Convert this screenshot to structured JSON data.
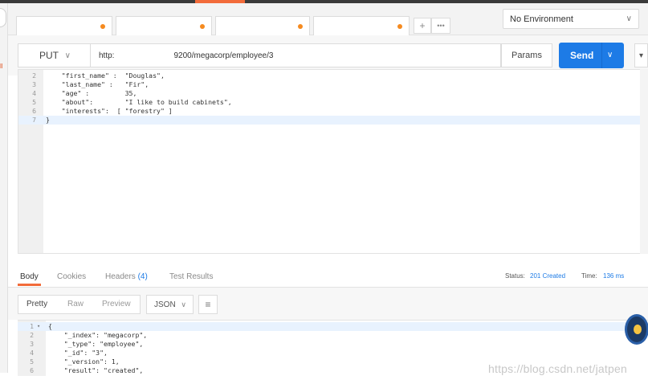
{
  "environment": {
    "selected": "No Environment"
  },
  "tabs": [
    {
      "label": "",
      "unsaved": true
    },
    {
      "label": "",
      "unsaved": true
    },
    {
      "label": "",
      "unsaved": true
    },
    {
      "label": "",
      "unsaved": true
    }
  ],
  "tab_actions": {
    "add": "+",
    "more": "•••"
  },
  "request": {
    "method": "PUT",
    "url_prefix": "http:",
    "url_suffix": "9200/megacorp/employee/3",
    "params_label": "Params",
    "send_label": "Send"
  },
  "left_edge": {
    "label": "ll"
  },
  "body_editor": {
    "lines": [
      {
        "num": "2",
        "text": "    \"first_name\" :  \"Douglas\","
      },
      {
        "num": "3",
        "text": "    \"last_name\" :   \"Fir\","
      },
      {
        "num": "4",
        "text": "    \"age\" :         35,"
      },
      {
        "num": "5",
        "text": "    \"about\":        \"I like to build cabinets\","
      },
      {
        "num": "6",
        "text": "    \"interests\":  [ \"forestry\" ]"
      },
      {
        "num": "7",
        "text": "}"
      }
    ]
  },
  "response": {
    "tabs": [
      {
        "label": "Body"
      },
      {
        "label": "Cookies"
      },
      {
        "label": "Headers",
        "count": "(4)"
      },
      {
        "label": "Test Results"
      }
    ],
    "status_label": "Status:",
    "status_value": "201 Created",
    "time_label": "Time:",
    "time_value": "136 ms",
    "formats": [
      "Pretty",
      "Raw",
      "Preview"
    ],
    "language": "JSON",
    "lines": [
      {
        "num": "1",
        "text": "{"
      },
      {
        "num": "2",
        "text": "    \"_index\": \"megacorp\","
      },
      {
        "num": "3",
        "text": "    \"_type\": \"employee\","
      },
      {
        "num": "4",
        "text": "    \"_id\": \"3\","
      },
      {
        "num": "5",
        "text": "    \"_version\": 1,"
      },
      {
        "num": "6",
        "text": "    \"result\": \"created\","
      }
    ]
  },
  "watermark": "https://blog.csdn.net/jatpen",
  "colors": {
    "accent": "#f26b3a",
    "primary": "#1d7be6",
    "unsaved_dot": "#f58a1f"
  }
}
